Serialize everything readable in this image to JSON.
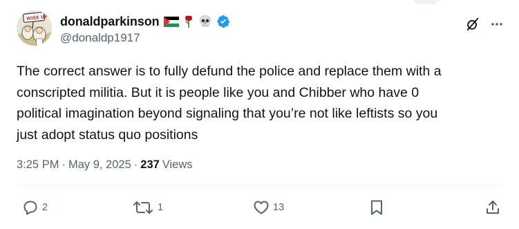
{
  "author": {
    "display_name": "donaldparkinson",
    "handle": "@donaldp1917",
    "name_emojis": [
      "palestine-flag",
      "rose",
      "skull"
    ],
    "verified": true,
    "avatar_sign_text": "WISE UP!"
  },
  "tweet": {
    "text": "The correct answer is to fully defund the police and replace them with a\nconscripted militia. But it is people like you and Chibber who have 0\npolitical imagination beyond signaling that you’re not like leftists so you\njust adopt status quo positions"
  },
  "meta": {
    "time": "3:25 PM",
    "separator1": "·",
    "date": "May 9, 2025",
    "separator2": "·",
    "views_count": "237",
    "views_label": "Views"
  },
  "actions": {
    "replies": "2",
    "reposts": "1",
    "likes": "13"
  },
  "colors": {
    "text_primary": "#0f1419",
    "text_secondary": "#536471",
    "verified_blue": "#1d9bf0",
    "divider": "#eff3f4"
  },
  "icons": {
    "grok": "grok-icon",
    "more": "more-icon",
    "reply": "reply-icon",
    "repost": "repost-icon",
    "like": "like-icon",
    "bookmark": "bookmark-icon",
    "share": "share-icon"
  }
}
